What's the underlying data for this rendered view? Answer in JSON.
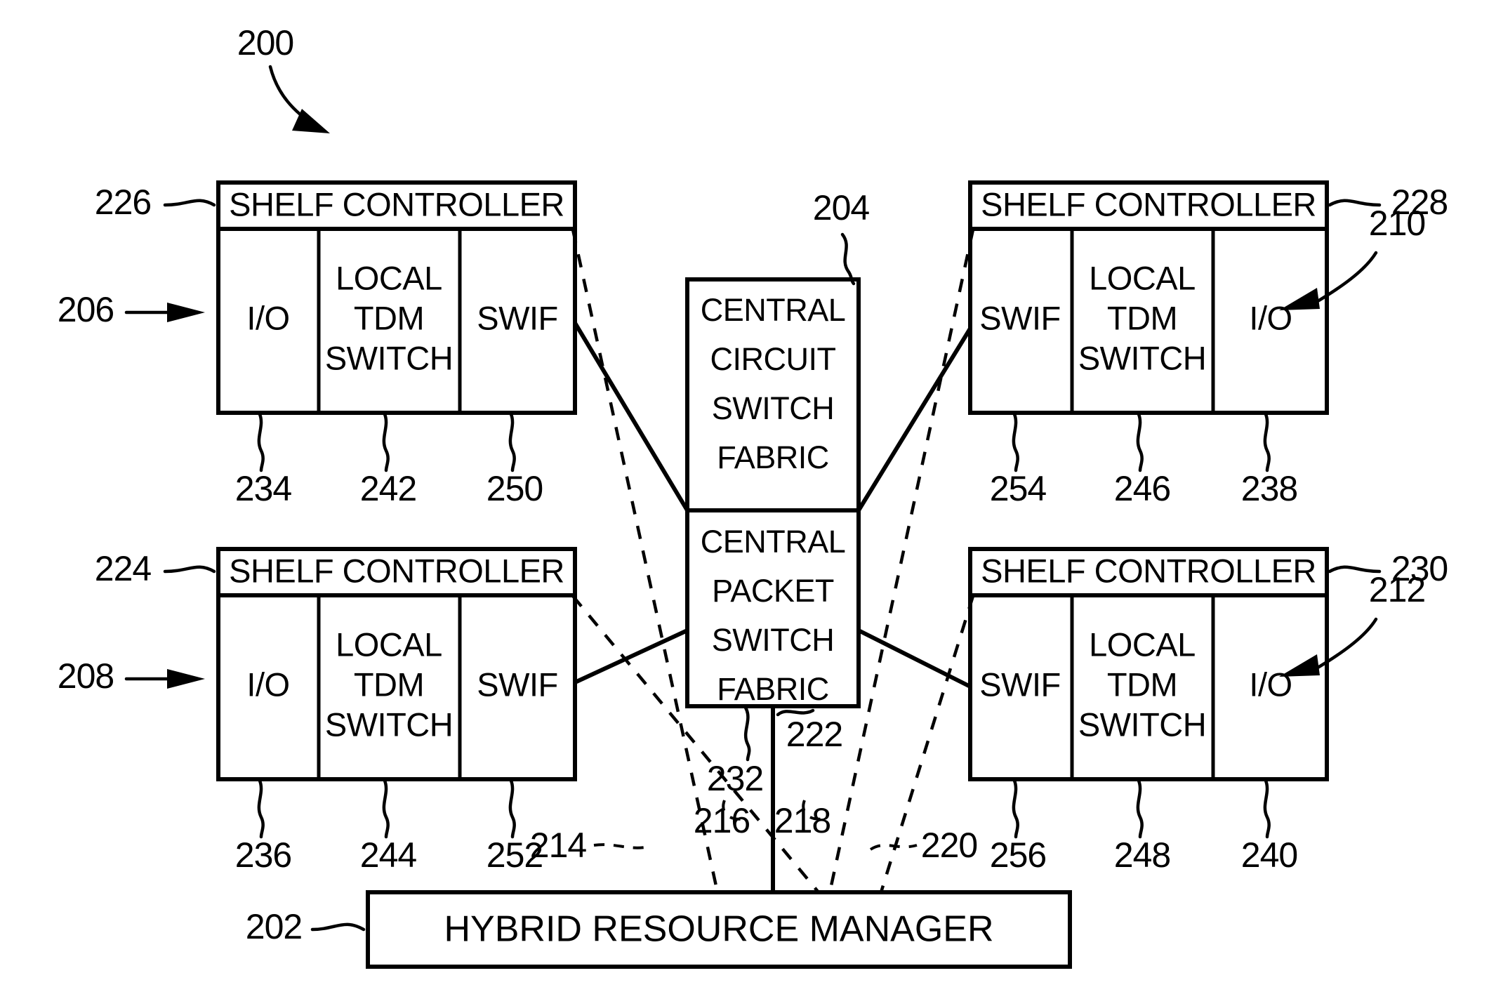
{
  "figure": {
    "id": "200",
    "type": "patent-block-diagram"
  },
  "central": {
    "ref": "204",
    "circuit_fabric": [
      "CENTRAL",
      "CIRCUIT",
      "SWITCH",
      "FABRIC"
    ],
    "packet_fabric": [
      "CENTRAL",
      "PACKET",
      "SWITCH",
      "FABRIC"
    ]
  },
  "manager": {
    "ref": "202",
    "label": "HYBRID RESOURCE MANAGER"
  },
  "shelves": [
    {
      "ref": "206",
      "controller_ref": "226",
      "controller_label": "SHELF CONTROLLER",
      "cells": [
        {
          "label": [
            "I/O"
          ],
          "ref": "234"
        },
        {
          "label": [
            "LOCAL",
            "TDM",
            "SWITCH"
          ],
          "ref": "242"
        },
        {
          "label": [
            "SWIF"
          ],
          "ref": "250"
        }
      ]
    },
    {
      "ref": "210",
      "controller_ref": "228",
      "controller_label": "SHELF CONTROLLER",
      "cells": [
        {
          "label": [
            "SWIF"
          ],
          "ref": "254"
        },
        {
          "label": [
            "LOCAL",
            "TDM",
            "SWITCH"
          ],
          "ref": "246"
        },
        {
          "label": [
            "I/O"
          ],
          "ref": "238"
        }
      ]
    },
    {
      "ref": "208",
      "controller_ref": "224",
      "controller_label": "SHELF CONTROLLER",
      "cells": [
        {
          "label": [
            "I/O"
          ],
          "ref": "236"
        },
        {
          "label": [
            "LOCAL",
            "TDM",
            "SWITCH"
          ],
          "ref": "244"
        },
        {
          "label": [
            "SWIF"
          ],
          "ref": "252"
        }
      ]
    },
    {
      "ref": "212",
      "controller_ref": "230",
      "controller_label": "SHELF CONTROLLER",
      "cells": [
        {
          "label": [
            "SWIF"
          ],
          "ref": "256"
        },
        {
          "label": [
            "LOCAL",
            "TDM",
            "SWITCH"
          ],
          "ref": "248"
        },
        {
          "label": [
            "I/O"
          ],
          "ref": "240"
        }
      ]
    }
  ],
  "link_refs": {
    "circuit_bus": "232",
    "packet_bus": "222",
    "ctrl_left_top": "214",
    "ctrl_left_bottom": "216",
    "ctrl_right_top": "218",
    "ctrl_right_bottom": "220"
  },
  "colors": {
    "ink": "#000000",
    "paper": "#ffffff"
  }
}
